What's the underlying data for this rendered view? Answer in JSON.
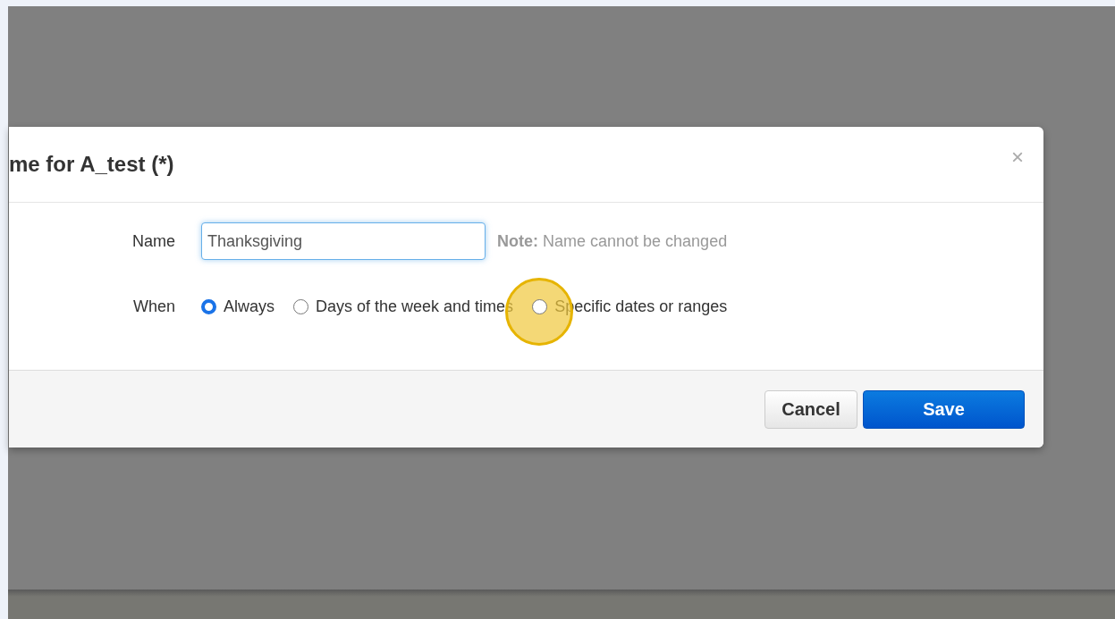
{
  "dialog": {
    "title": "me for A_test (*)",
    "close": "×",
    "name_field": {
      "label": "Name",
      "value": "Thanksgiving",
      "note_bold": "Note:",
      "note": "Name cannot be changed"
    },
    "when": {
      "label": "When",
      "options": [
        {
          "label": "Always",
          "selected": true,
          "highlighted": false
        },
        {
          "label": "Days of the week and times",
          "selected": false,
          "highlighted": false
        },
        {
          "label": "Specific dates or ranges",
          "selected": false,
          "highlighted": true
        }
      ]
    },
    "buttons": [
      {
        "label": "Cancel",
        "kind": "secondary"
      },
      {
        "label": "Save",
        "kind": "primary"
      }
    ]
  }
}
